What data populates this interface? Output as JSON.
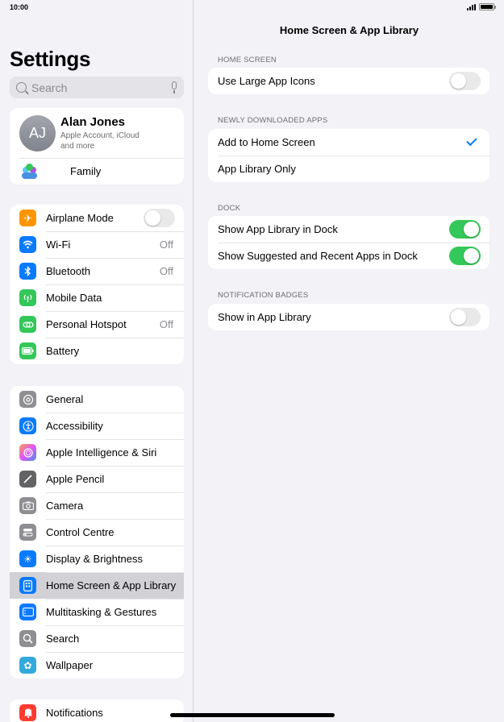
{
  "status": {
    "time": "10:00"
  },
  "sidebar": {
    "title": "Settings",
    "search_placeholder": "Search",
    "profile": {
      "initials": "AJ",
      "name": "Alan Jones",
      "subtitle_line1": "Apple Account, iCloud",
      "subtitle_line2": "and more"
    },
    "family_label": "Family",
    "connectivity": [
      {
        "label": "Airplane Mode",
        "value": "",
        "icon": "airplane-icon",
        "color": "#ff9500"
      },
      {
        "label": "Wi-Fi",
        "value": "Off",
        "icon": "wifi-icon",
        "color": "#0a7aff"
      },
      {
        "label": "Bluetooth",
        "value": "Off",
        "icon": "bluetooth-icon",
        "color": "#0a7aff"
      },
      {
        "label": "Mobile Data",
        "value": "",
        "icon": "antenna-icon",
        "color": "#34c759"
      },
      {
        "label": "Personal Hotspot",
        "value": "Off",
        "icon": "hotspot-icon",
        "color": "#34c759"
      },
      {
        "label": "Battery",
        "value": "",
        "icon": "battery-icon",
        "color": "#34c759"
      }
    ],
    "general_items": [
      {
        "label": "General",
        "icon": "gear-icon",
        "color": "#8e8e93"
      },
      {
        "label": "Accessibility",
        "icon": "accessibility-icon",
        "color": "#0a7aff"
      },
      {
        "label": "Apple Intelligence & Siri",
        "icon": "siri-icon",
        "color": "#c86dd7"
      },
      {
        "label": "Apple Pencil",
        "icon": "pencil-icon",
        "color": "#636366"
      },
      {
        "label": "Camera",
        "icon": "camera-icon",
        "color": "#8e8e93"
      },
      {
        "label": "Control Centre",
        "icon": "control-centre-icon",
        "color": "#8e8e93"
      },
      {
        "label": "Display & Brightness",
        "icon": "sun-icon",
        "color": "#0a7aff"
      },
      {
        "label": "Home Screen & App Library",
        "icon": "home-screen-icon",
        "color": "#0a7aff"
      },
      {
        "label": "Multitasking & Gestures",
        "icon": "multitasking-icon",
        "color": "#0a7aff"
      },
      {
        "label": "Search",
        "icon": "search-icon",
        "color": "#8e8e93"
      },
      {
        "label": "Wallpaper",
        "icon": "wallpaper-icon",
        "color": "#34aadc"
      }
    ],
    "notifications_label": "Notifications",
    "airplane_mode_on": false
  },
  "main": {
    "title": "Home Screen & App Library",
    "home_screen": {
      "header": "HOME SCREEN",
      "large_icons_label": "Use Large App Icons",
      "large_icons_on": false
    },
    "newly_downloaded": {
      "header": "NEWLY DOWNLOADED APPS",
      "options": [
        "Add to Home Screen",
        "App Library Only"
      ],
      "selected": "Add to Home Screen"
    },
    "dock": {
      "header": "DOCK",
      "show_library_label": "Show App Library in Dock",
      "show_library_on": true,
      "show_suggested_label": "Show Suggested and Recent Apps in Dock",
      "show_suggested_on": true
    },
    "badges": {
      "header": "NOTIFICATION BADGES",
      "show_in_library_label": "Show in App Library",
      "show_in_library_on": false
    }
  }
}
